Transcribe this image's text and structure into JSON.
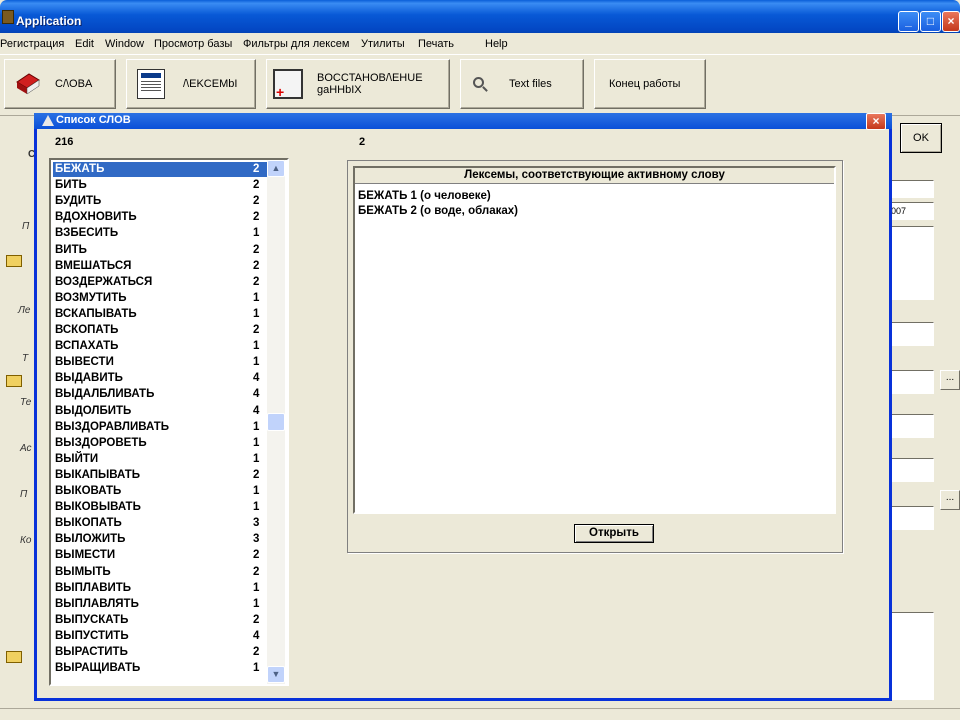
{
  "window": {
    "title": "Application"
  },
  "menu": [
    "Регистрация",
    "Edit",
    "Window",
    "Просмотр базы",
    "Фильтры для лексем",
    "Утилиты",
    "Печать",
    "Help"
  ],
  "toolbar": {
    "words_label": "C/\\OBA",
    "lexemes_label": "/\\EKCEMbI",
    "restore_label": "BOCCTAHOB/\\EHUE\ngaHHbIX",
    "textfiles_label": "Text files",
    "exit_label": "Конец работы"
  },
  "background": {
    "ok_label": "OK",
    "field_value": "007",
    "side_labels": [
      "С",
      "П",
      "Ле",
      "Т",
      "Те",
      "Ас",
      "П",
      "Ко"
    ]
  },
  "dialog": {
    "title": "Список СЛОВ",
    "word_count": "216",
    "lexeme_count": "2",
    "lexeme_header": "Лексемы, соответствующие активному слову",
    "lexemes": [
      "БЕЖАТЬ 1 (о человеке)",
      "БЕЖАТЬ 2 (о воде, облаках)"
    ],
    "open_label": "Открыть",
    "words": [
      {
        "word": "БЕЖАТЬ",
        "n": "2"
      },
      {
        "word": "БИТЬ",
        "n": "2"
      },
      {
        "word": "БУДИТЬ",
        "n": "2"
      },
      {
        "word": "ВДОХНОВИТЬ",
        "n": "2"
      },
      {
        "word": "ВЗБЕСИТЬ",
        "n": "1"
      },
      {
        "word": "ВИТЬ",
        "n": "2"
      },
      {
        "word": "ВМЕШАТЬСЯ",
        "n": "2"
      },
      {
        "word": "ВОЗДЕРЖАТЬСЯ",
        "n": "2"
      },
      {
        "word": "ВОЗМУТИТЬ",
        "n": "1"
      },
      {
        "word": "ВСКАПЫВАТЬ",
        "n": "1"
      },
      {
        "word": "ВСКОПАТЬ",
        "n": "2"
      },
      {
        "word": "ВСПАХАТЬ",
        "n": "1"
      },
      {
        "word": "ВЫВЕСТИ",
        "n": "1"
      },
      {
        "word": "ВЫДАВИТЬ",
        "n": "4"
      },
      {
        "word": "ВЫДАЛБЛИВАТЬ",
        "n": "4"
      },
      {
        "word": "ВЫДОЛБИТЬ",
        "n": "4"
      },
      {
        "word": "ВЫЗДОРАВЛИВАТЬ",
        "n": "1"
      },
      {
        "word": "ВЫЗДОРОВЕТЬ",
        "n": "1"
      },
      {
        "word": "ВЫЙТИ",
        "n": "1"
      },
      {
        "word": "ВЫКАПЫВАТЬ",
        "n": "2"
      },
      {
        "word": "ВЫКОВАТЬ",
        "n": "1"
      },
      {
        "word": "ВЫКОВЫВАТЬ",
        "n": "1"
      },
      {
        "word": "ВЫКОПАТЬ",
        "n": "3"
      },
      {
        "word": "ВЫЛОЖИТЬ",
        "n": "3"
      },
      {
        "word": "ВЫМЕСТИ",
        "n": "2"
      },
      {
        "word": "ВЫМЫТЬ",
        "n": "2"
      },
      {
        "word": "ВЫПЛАВИТЬ",
        "n": "1"
      },
      {
        "word": "ВЫПЛАВЛЯТЬ",
        "n": "1"
      },
      {
        "word": "ВЫПУСКАТЬ",
        "n": "2"
      },
      {
        "word": "ВЫПУСТИТЬ",
        "n": "4"
      },
      {
        "word": "ВЫРАСТИТЬ",
        "n": "2"
      },
      {
        "word": "ВЫРАЩИВАТЬ",
        "n": "1"
      }
    ]
  }
}
